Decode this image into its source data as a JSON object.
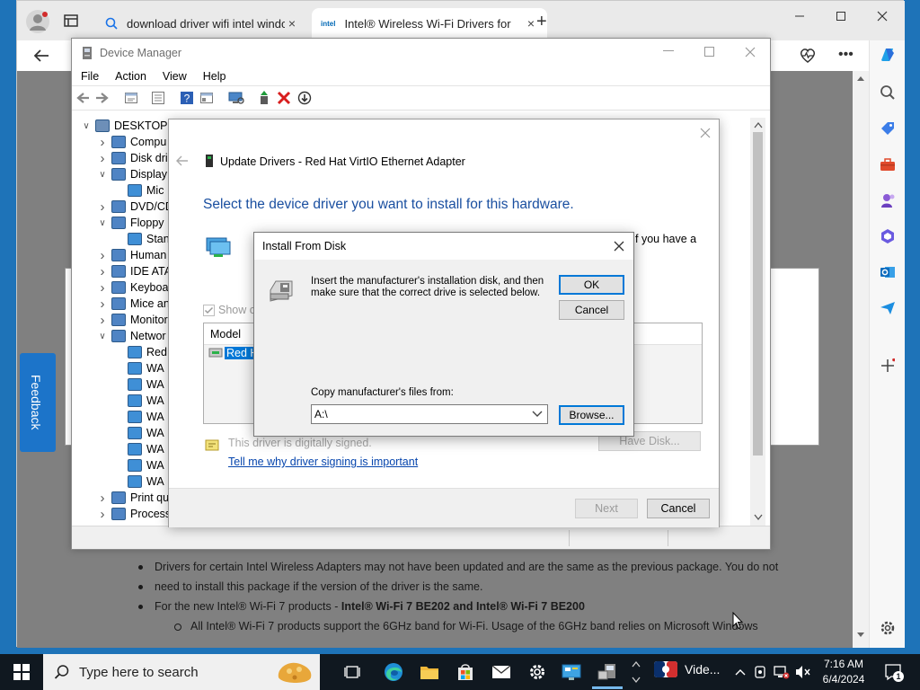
{
  "browser": {
    "tabs": [
      {
        "title": "download driver wifi intel windo",
        "active": false
      },
      {
        "title": "Intel® Wireless Wi-Fi Drivers for",
        "active": true
      }
    ],
    "new_tab": "+",
    "tab_close": "×",
    "page": {
      "bullets": [
        "Drivers for certain Intel Wireless Adapters may not have been updated and are the same as the previous package. You do not",
        "need to install this package if the version of the driver is the same.",
        "For the new Intel® Wi-Fi 7 products - ",
        "Intel® Wi-Fi 7 BE202 and Intel® Wi-Fi 7 BE200",
        "All Intel® Wi-Fi 7 products support the 6GHz band for Wi-Fi. Usage of the 6GHz band relies on Microsoft Windows"
      ]
    },
    "feedback_label": "Feedback"
  },
  "device_manager": {
    "title": "Device Manager",
    "menu": [
      "File",
      "Action",
      "View",
      "Help"
    ],
    "tree": [
      {
        "label": "DESKTOP-2",
        "level": 0,
        "caret": "down"
      },
      {
        "label": "Compu",
        "level": 1,
        "caret": "right"
      },
      {
        "label": "Disk dri",
        "level": 1,
        "caret": "right"
      },
      {
        "label": "Display",
        "level": 1,
        "caret": "down"
      },
      {
        "label": "Mic",
        "level": 2,
        "caret": ""
      },
      {
        "label": "DVD/CD",
        "level": 1,
        "caret": "right"
      },
      {
        "label": "Floppy",
        "level": 1,
        "caret": "down"
      },
      {
        "label": "Stan",
        "level": 2,
        "caret": ""
      },
      {
        "label": "Human",
        "level": 1,
        "caret": "right"
      },
      {
        "label": "IDE ATA",
        "level": 1,
        "caret": "right"
      },
      {
        "label": "Keyboa",
        "level": 1,
        "caret": "right"
      },
      {
        "label": "Mice an",
        "level": 1,
        "caret": "right"
      },
      {
        "label": "Monitor",
        "level": 1,
        "caret": "right"
      },
      {
        "label": "Networ",
        "level": 1,
        "caret": "down"
      },
      {
        "label": "Red",
        "level": 2,
        "caret": ""
      },
      {
        "label": "WA",
        "level": 2,
        "caret": ""
      },
      {
        "label": "WA",
        "level": 2,
        "caret": ""
      },
      {
        "label": "WA",
        "level": 2,
        "caret": ""
      },
      {
        "label": "WA",
        "level": 2,
        "caret": ""
      },
      {
        "label": "WA",
        "level": 2,
        "caret": ""
      },
      {
        "label": "WA",
        "level": 2,
        "caret": ""
      },
      {
        "label": "WA",
        "level": 2,
        "caret": ""
      },
      {
        "label": "WA",
        "level": 2,
        "caret": ""
      },
      {
        "label": "Print qu",
        "level": 1,
        "caret": "right"
      },
      {
        "label": "Process",
        "level": 1,
        "caret": "right"
      }
    ]
  },
  "update_drivers": {
    "title": "Update Drivers - Red Hat VirtIO Ethernet Adapter",
    "heading": "Select the device driver you want to install for this hardware.",
    "side_text": "f you have a",
    "show_compatible": "Show c",
    "model_header": "Model",
    "model_item": "Red H",
    "signed_text": "This driver is digitally signed.",
    "signing_link": "Tell me why driver signing is important",
    "have_disk": "Have Disk...",
    "next": "Next",
    "cancel": "Cancel"
  },
  "install_from_disk": {
    "title": "Install From Disk",
    "message": "Insert the manufacturer's installation disk, and then make sure that the correct drive is selected below.",
    "ok": "OK",
    "cancel": "Cancel",
    "copy_label": "Copy manufacturer's files from:",
    "path_value": "A:\\",
    "browse": "Browse..."
  },
  "taskbar": {
    "search_placeholder": "Type here to search",
    "weather_label": "Vide...",
    "time": "7:16 AM",
    "date": "6/4/2024",
    "notification_count": "1"
  }
}
